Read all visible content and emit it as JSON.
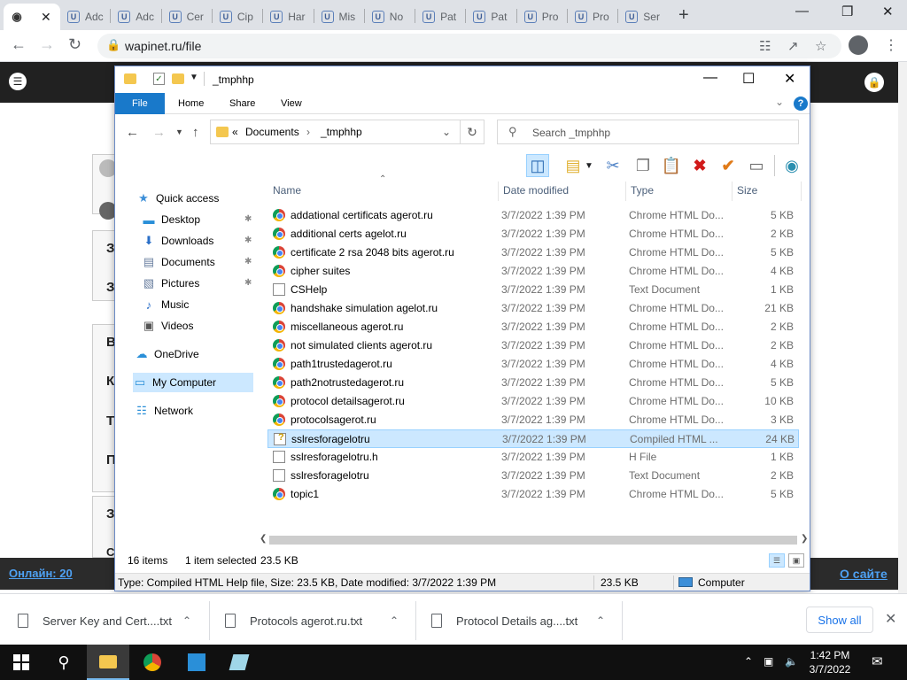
{
  "browser": {
    "tabs": [
      {
        "label": "",
        "icon": "eye-icon",
        "active": true
      },
      {
        "label": "Adc"
      },
      {
        "label": "Adc"
      },
      {
        "label": "Cer"
      },
      {
        "label": "Cip"
      },
      {
        "label": "Har"
      },
      {
        "label": "Mis"
      },
      {
        "label": "No"
      },
      {
        "label": "Pat"
      },
      {
        "label": "Pat"
      },
      {
        "label": "Pro"
      },
      {
        "label": "Pro"
      },
      {
        "label": "Ser"
      }
    ],
    "url": "wapinet.ru/file"
  },
  "site": {
    "letters": [
      "З",
      "З",
      "В",
      "К",
      "Т",
      "П",
      "З",
      "С"
    ],
    "online_link": "Онлайн: 20",
    "about_link": "О сайте"
  },
  "explorer": {
    "title": "_tmphhp",
    "ribbon_tabs": [
      "File",
      "Home",
      "Share",
      "View"
    ],
    "breadcrumb": {
      "overflow": "«",
      "items": [
        "Documents",
        "_tmphhp"
      ]
    },
    "search_placeholder": "Search _tmphhp",
    "nav": [
      {
        "label": "Quick access",
        "icon": "star-icon"
      },
      {
        "label": "Desktop",
        "icon": "desktop-icon",
        "pinned": true
      },
      {
        "label": "Downloads",
        "icon": "download-icon",
        "pinned": true
      },
      {
        "label": "Documents",
        "icon": "documents-icon",
        "pinned": true
      },
      {
        "label": "Pictures",
        "icon": "pictures-icon",
        "pinned": true
      },
      {
        "label": "Music",
        "icon": "music-icon"
      },
      {
        "label": "Videos",
        "icon": "videos-icon"
      },
      {
        "label": "OneDrive",
        "icon": "cloud-icon"
      },
      {
        "label": "My Computer",
        "icon": "computer-icon",
        "selected": true
      },
      {
        "label": "Network",
        "icon": "network-icon"
      }
    ],
    "columns": {
      "name": "Name",
      "date": "Date modified",
      "type": "Type",
      "size": "Size"
    },
    "files": [
      {
        "name": "addational certificats  agerot.ru",
        "date": "3/7/2022 1:39 PM",
        "type": "Chrome HTML Do...",
        "size": "5 KB",
        "icon": "chrome"
      },
      {
        "name": "additional certs agelot.ru",
        "date": "3/7/2022 1:39 PM",
        "type": "Chrome HTML Do...",
        "size": "2 KB",
        "icon": "chrome"
      },
      {
        "name": "certificate 2 rsa 2048 bits agerot.ru",
        "date": "3/7/2022 1:39 PM",
        "type": "Chrome HTML Do...",
        "size": "5 KB",
        "icon": "chrome"
      },
      {
        "name": "cipher suites",
        "date": "3/7/2022 1:39 PM",
        "type": "Chrome HTML Do...",
        "size": "4 KB",
        "icon": "chrome"
      },
      {
        "name": "CSHelp",
        "date": "3/7/2022 1:39 PM",
        "type": "Text Document",
        "size": "1 KB",
        "icon": "txt"
      },
      {
        "name": "handshake simulation agelot.ru",
        "date": "3/7/2022 1:39 PM",
        "type": "Chrome HTML Do...",
        "size": "21 KB",
        "icon": "chrome"
      },
      {
        "name": "miscellaneous agerot.ru",
        "date": "3/7/2022 1:39 PM",
        "type": "Chrome HTML Do...",
        "size": "2 KB",
        "icon": "chrome"
      },
      {
        "name": "not simulated clients agerot.ru",
        "date": "3/7/2022 1:39 PM",
        "type": "Chrome HTML Do...",
        "size": "2 KB",
        "icon": "chrome"
      },
      {
        "name": "path1trustedagerot.ru",
        "date": "3/7/2022 1:39 PM",
        "type": "Chrome HTML Do...",
        "size": "4 KB",
        "icon": "chrome"
      },
      {
        "name": "path2notrustedagerot.ru",
        "date": "3/7/2022 1:39 PM",
        "type": "Chrome HTML Do...",
        "size": "5 KB",
        "icon": "chrome"
      },
      {
        "name": "protocol detailsagerot.ru",
        "date": "3/7/2022 1:39 PM",
        "type": "Chrome HTML Do...",
        "size": "10 KB",
        "icon": "chrome"
      },
      {
        "name": "protocolsagerot.ru",
        "date": "3/7/2022 1:39 PM",
        "type": "Chrome HTML Do...",
        "size": "3 KB",
        "icon": "chrome"
      },
      {
        "name": "sslresforagelotru",
        "date": "3/7/2022 1:39 PM",
        "type": "Compiled HTML ...",
        "size": "24 KB",
        "icon": "chm",
        "selected": true
      },
      {
        "name": "sslresforagelotru.h",
        "date": "3/7/2022 1:39 PM",
        "type": "H File",
        "size": "1 KB",
        "icon": "txt"
      },
      {
        "name": "sslresforagelotru",
        "date": "3/7/2022 1:39 PM",
        "type": "Text Document",
        "size": "2 KB",
        "icon": "txt"
      },
      {
        "name": "topic1",
        "date": "3/7/2022 1:39 PM",
        "type": "Chrome HTML Do...",
        "size": "5 KB",
        "icon": "chrome"
      }
    ],
    "status": {
      "count": "16 items",
      "selected": "1 item selected",
      "selected_size": "23.5 KB"
    },
    "details": {
      "text": "Type: Compiled HTML Help file, Size: 23.5 KB, Date modified: 3/7/2022 1:39 PM",
      "size": "23.5 KB",
      "location": "Computer"
    }
  },
  "downloads": {
    "items": [
      "Server Key and Cert....txt",
      "Protocols agerot.ru.txt",
      "Protocol Details ag....txt"
    ],
    "show_all": "Show all"
  },
  "taskbar": {
    "time": "1:42 PM",
    "date": "3/7/2022"
  }
}
